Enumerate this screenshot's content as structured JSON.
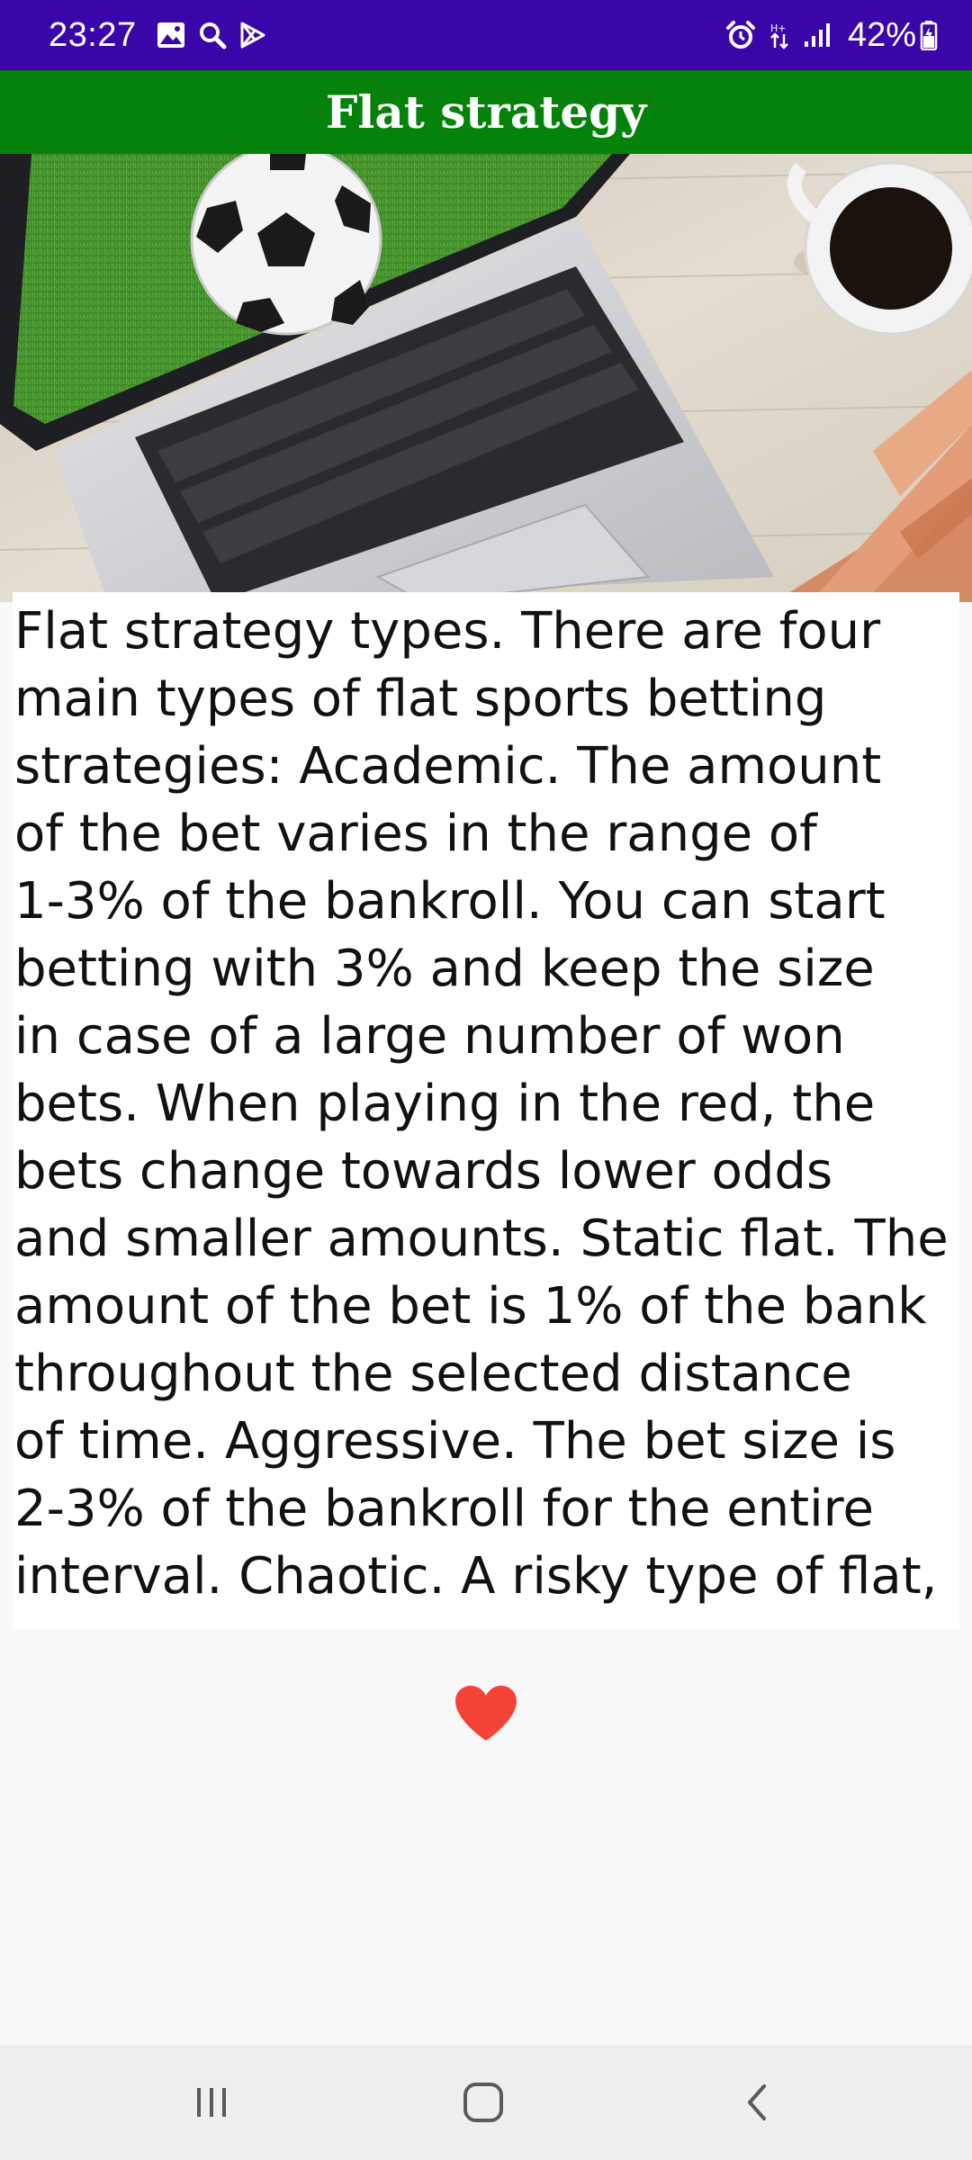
{
  "status_bar": {
    "time": "23:27",
    "battery": "42%",
    "left_icons": [
      "gallery-icon",
      "search-icon",
      "play-store-icon"
    ],
    "right_icons": [
      "alarm-icon",
      "data-transfer-icon",
      "signal-icon",
      "battery-icon"
    ]
  },
  "app_bar": {
    "title": "Flat strategy",
    "color": "#05820a"
  },
  "article": {
    "lines": [
      "Flat strategy types. There are four",
      "main types of flat sports betting",
      "strategies: Academic. The amount",
      "of the bet varies in the range of",
      "1-3% of the bankroll. You can start",
      "betting with 3% and keep the size",
      "in case of a large number of won",
      "bets. When playing in the red, the",
      "bets change towards lower odds",
      "and smaller amounts. Static flat. The",
      "amount of the bet is 1% of the bank",
      "throughout the selected distance",
      "of time. Aggressive. The bet size is",
      "2-3% of the bankroll for the entire",
      "interval. Chaotic. A risky type of flat,"
    ]
  },
  "favorite": {
    "icon": "heart-icon",
    "color": "#f44336"
  },
  "nav_bar": {
    "icons": [
      "recent-apps-icon",
      "home-icon",
      "back-icon"
    ]
  }
}
